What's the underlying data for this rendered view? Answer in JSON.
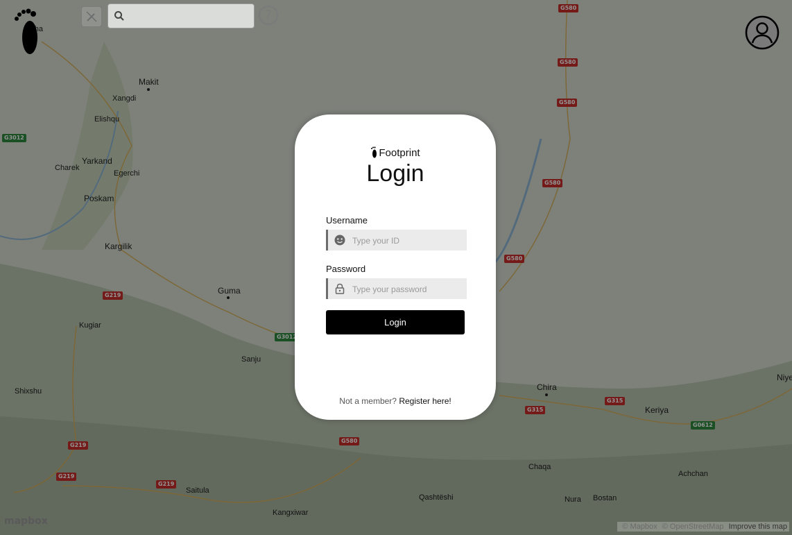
{
  "map": {
    "places": [
      {
        "name": "Yengisar",
        "label": "rgha"
      },
      {
        "name": "Makit",
        "label": "Makit"
      },
      {
        "name": "Xangdi",
        "label": "Xangdi"
      },
      {
        "name": "Elishqu",
        "label": "Elishqu"
      },
      {
        "name": "Yarkand",
        "label": "Yarkand"
      },
      {
        "name": "Charek",
        "label": "Charek"
      },
      {
        "name": "Egerchi",
        "label": "Egerchi"
      },
      {
        "name": "Poskam",
        "label": "Poskam"
      },
      {
        "name": "Kargilik",
        "label": "Kargilik"
      },
      {
        "name": "Guma",
        "label": "Guma"
      },
      {
        "name": "Kugiar",
        "label": "Kugiar"
      },
      {
        "name": "Sanju",
        "label": "Sanju"
      },
      {
        "name": "Shixshu",
        "label": "Shixshu"
      },
      {
        "name": "Saitula",
        "label": "Saitula"
      },
      {
        "name": "Kangxiwar",
        "label": "Kangxiwar"
      },
      {
        "name": "Qashteshi",
        "label": "Qashtëshi"
      },
      {
        "name": "Chira",
        "label": "Chira"
      },
      {
        "name": "Keriya",
        "label": "Keriya"
      },
      {
        "name": "Niye",
        "label": "Niye"
      },
      {
        "name": "Chaqa",
        "label": "Chaqa"
      },
      {
        "name": "Achchan",
        "label": "Achchan"
      },
      {
        "name": "Nura",
        "label": "Nura"
      },
      {
        "name": "Bostan",
        "label": "Bostan"
      }
    ],
    "shields": {
      "g580": "G580",
      "g3012": "G3012",
      "g219": "G219",
      "g315": "G315",
      "g0612": "G0612"
    },
    "attribution": {
      "mapbox": "© Mapbox",
      "osm": "© OpenStreetMap",
      "improve": "Improve this map"
    },
    "mapbox_logo": "mapbox"
  },
  "toolbar": {
    "search_value": "",
    "help_label": "?"
  },
  "login": {
    "brand": "Footprint",
    "title": "Login",
    "username_label": "Username",
    "username_placeholder": "Type your ID",
    "password_label": "Password",
    "password_placeholder": "Type your password",
    "submit_label": "Login",
    "register_prompt": "Not a member?",
    "register_link": "Register here!"
  },
  "colors": {
    "card_bg": "#ffffff",
    "button_bg": "#000000",
    "field_bg": "#ebebeb",
    "road_shield_red": "#c8302b",
    "road_shield_green": "#2e8b3f"
  }
}
